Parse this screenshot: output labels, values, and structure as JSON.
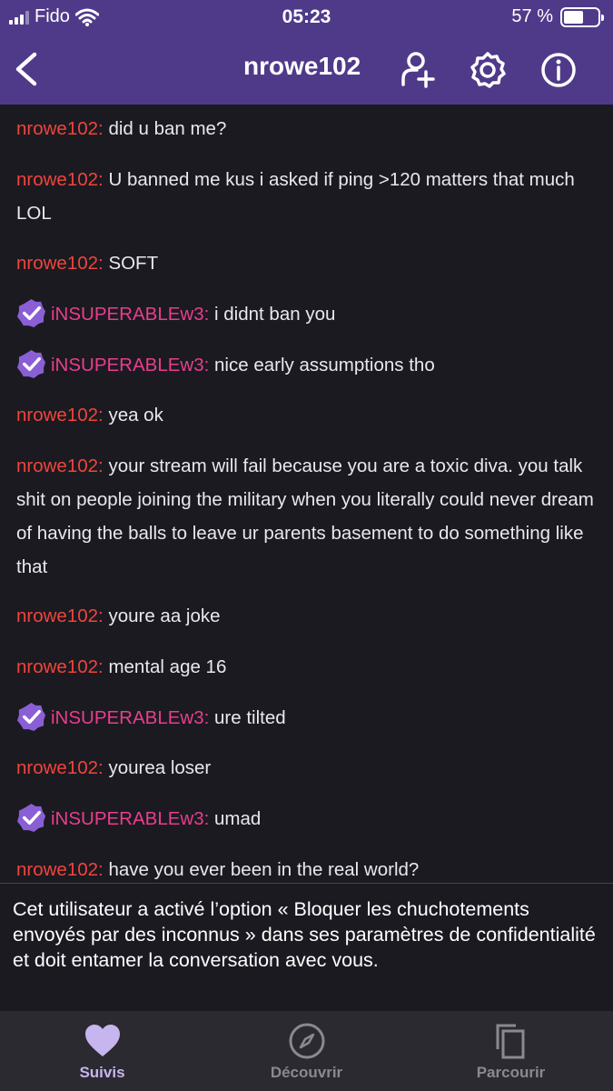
{
  "status_bar": {
    "carrier": "Fido",
    "time": "05:23",
    "battery": "57 %",
    "battery_level": 0.57
  },
  "nav": {
    "title": "nrowe102",
    "icons": [
      "back-icon",
      "add-friend-icon",
      "settings-icon",
      "info-icon"
    ]
  },
  "messages": [
    {
      "user": "nrowe102:",
      "text": "did u ban me?",
      "verified": false
    },
    {
      "user": "nrowe102:",
      "text": "U banned me kus i asked if ping >120 matters that much LOL",
      "verified": false
    },
    {
      "user": "nrowe102:",
      "text": "SOFT",
      "verified": false
    },
    {
      "user": "iNSUPERABLEw3:",
      "text": "i didnt ban you",
      "verified": true
    },
    {
      "user": "iNSUPERABLEw3:",
      "text": "nice early assumptions tho",
      "verified": true
    },
    {
      "user": "nrowe102:",
      "text": "yea ok",
      "verified": false
    },
    {
      "user": "nrowe102:",
      "text": "your stream will fail because you are a toxic diva. you talk shit on people joining the military when you literally could never dream of having the balls to leave ur parents basement to do something like that",
      "verified": false
    },
    {
      "user": "nrowe102:",
      "text": "youre aa joke",
      "verified": false
    },
    {
      "user": "nrowe102:",
      "text": "mental age 16",
      "verified": false
    },
    {
      "user": "iNSUPERABLEw3:",
      "text": "ure tilted",
      "verified": true
    },
    {
      "user": "nrowe102:",
      "text": "yourea loser",
      "verified": false
    },
    {
      "user": "iNSUPERABLEw3:",
      "text": "umad",
      "verified": true
    },
    {
      "user": "nrowe102:",
      "text": "have you ever been in the real world?",
      "verified": false
    }
  ],
  "notice": {
    "text": "Cet utilisateur a activé l’option « Bloquer les chuchotements envoyés par des inconnus » dans ses paramètres de confidentialité et doit entamer la conversation avec vous."
  },
  "tabs": [
    {
      "label": "Suivis",
      "icon": "heart-icon",
      "active": true
    },
    {
      "label": "Découvrir",
      "icon": "compass-icon",
      "active": false
    },
    {
      "label": "Parcourir",
      "icon": "browse-icon",
      "active": false
    }
  ],
  "colors": {
    "header": "#4f3a8a",
    "background": "#1b1a21",
    "username_viewer": "#f0443b",
    "username_streamer": "#e83e8c",
    "badge": "#8a5fd6",
    "tab_active": "#c7b5ef",
    "tab_inactive": "#8a8991"
  }
}
